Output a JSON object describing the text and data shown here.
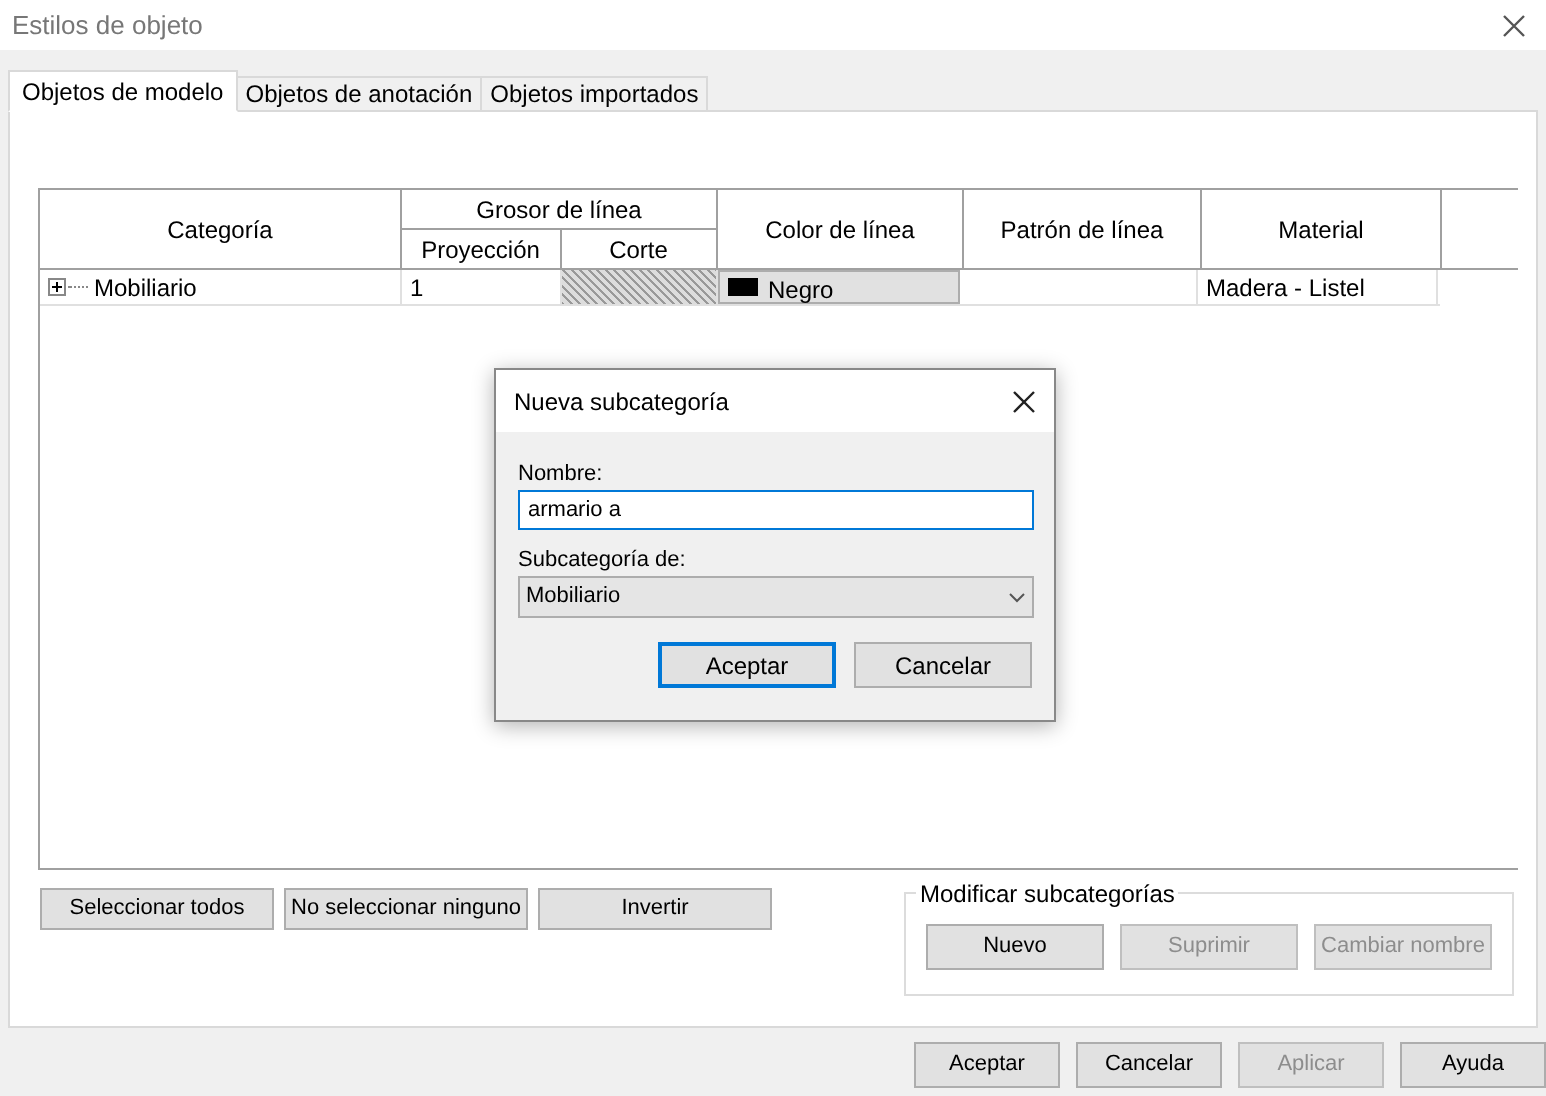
{
  "window": {
    "title": "Estilos de objeto"
  },
  "tabs": [
    {
      "label": "Objetos de modelo",
      "selected": true
    },
    {
      "label": "Objetos de anotación",
      "selected": false
    },
    {
      "label": "Objetos importados",
      "selected": false
    }
  ],
  "table": {
    "columns": [
      {
        "label": "Categoría"
      },
      {
        "label": "Grosor de línea",
        "children": [
          {
            "label": "Proyección"
          },
          {
            "label": "Corte"
          }
        ]
      },
      {
        "label": "Color de línea"
      },
      {
        "label": "Patrón de línea"
      },
      {
        "label": "Material"
      }
    ],
    "rows": [
      {
        "expanded": false,
        "category": "Mobiliario",
        "projection": "1",
        "color_name": "Negro",
        "color": "#000000",
        "pattern": "",
        "material": "Madera - Listel"
      }
    ]
  },
  "selection_buttons": [
    {
      "label": "Seleccionar todos"
    },
    {
      "label": "No seleccionar ninguno"
    },
    {
      "label": "Invertir"
    }
  ],
  "modify_group": {
    "title": "Modificar subcategorías",
    "buttons": [
      {
        "label": "Nuevo",
        "disabled": false
      },
      {
        "label": "Suprimir",
        "disabled": true
      },
      {
        "label": "Cambiar nombre",
        "disabled": true
      }
    ]
  },
  "footer_buttons": [
    {
      "label": "Aceptar",
      "disabled": false
    },
    {
      "label": "Cancelar",
      "disabled": false
    },
    {
      "label": "Aplicar",
      "disabled": true
    },
    {
      "label": "Ayuda",
      "disabled": false
    }
  ],
  "dialog": {
    "title": "Nueva subcategoría",
    "name_label": "Nombre:",
    "name_value": "armario a",
    "parent_label": "Subcategoría de:",
    "parent_value": "Mobiliario",
    "buttons": [
      {
        "label": "Aceptar",
        "default": true
      },
      {
        "label": "Cancelar",
        "default": false
      }
    ]
  }
}
